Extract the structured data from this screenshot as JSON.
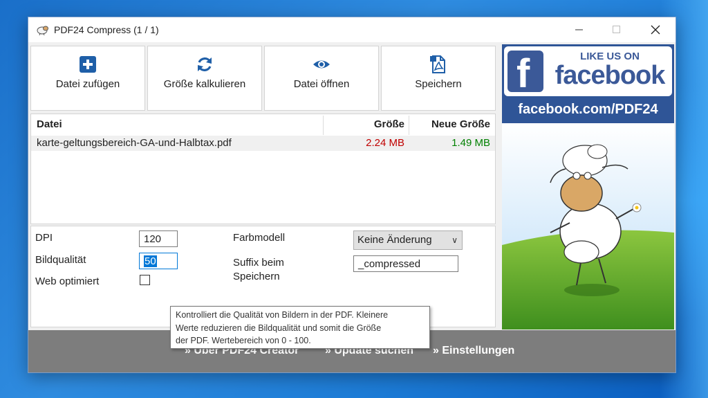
{
  "window": {
    "title": "PDF24 Compress (1 / 1)"
  },
  "toolbar": {
    "add_file": "Datei zufügen",
    "calculate_size": "Größe kalkulieren",
    "open_file": "Datei öffnen",
    "save": "Speichern"
  },
  "file_table": {
    "columns": {
      "file": "Datei",
      "size": "Größe",
      "new_size": "Neue Größe"
    },
    "rows": [
      {
        "file": "karte-geltungsbereich-GA-und-Halbtax.pdf",
        "size": "2.24 MB",
        "new_size": "1.49 MB"
      }
    ]
  },
  "options": {
    "dpi_label": "DPI",
    "dpi_value": "120",
    "quality_label": "Bildqualität",
    "quality_value": "50",
    "web_label": "Web optimiert",
    "web_checked": false,
    "color_model_label": "Farbmodell",
    "color_model_value": "Keine Änderung",
    "suffix_label_line1": "Suffix beim",
    "suffix_label_line2": "Speichern",
    "suffix_value": "_compressed"
  },
  "tooltip": {
    "line1": "Kontrolliert die Qualität von Bildern in der PDF. Kleinere",
    "line2": "Werte reduzieren die Bildqualität und somit die Größe",
    "line3": "der PDF. Wertebereich von 0 - 100."
  },
  "ad": {
    "like_us_on": "LIKE US ON",
    "facebook": "facebook",
    "url": "facebook.com/PDF24"
  },
  "footer": {
    "about": "Über PDF24 Creator",
    "update": "Update suchen",
    "settings": "Einstellungen"
  },
  "colors": {
    "old_size": "#c00000",
    "new_size": "#008000",
    "toolbar_icon": "#1f5fa8",
    "accent": "#0078d7",
    "facebook": "#3b5998"
  },
  "icons": {
    "add_file": "plus-icon",
    "calculate_size": "refresh-icon",
    "open_file": "eye-icon",
    "save": "pdf-save-icon"
  }
}
